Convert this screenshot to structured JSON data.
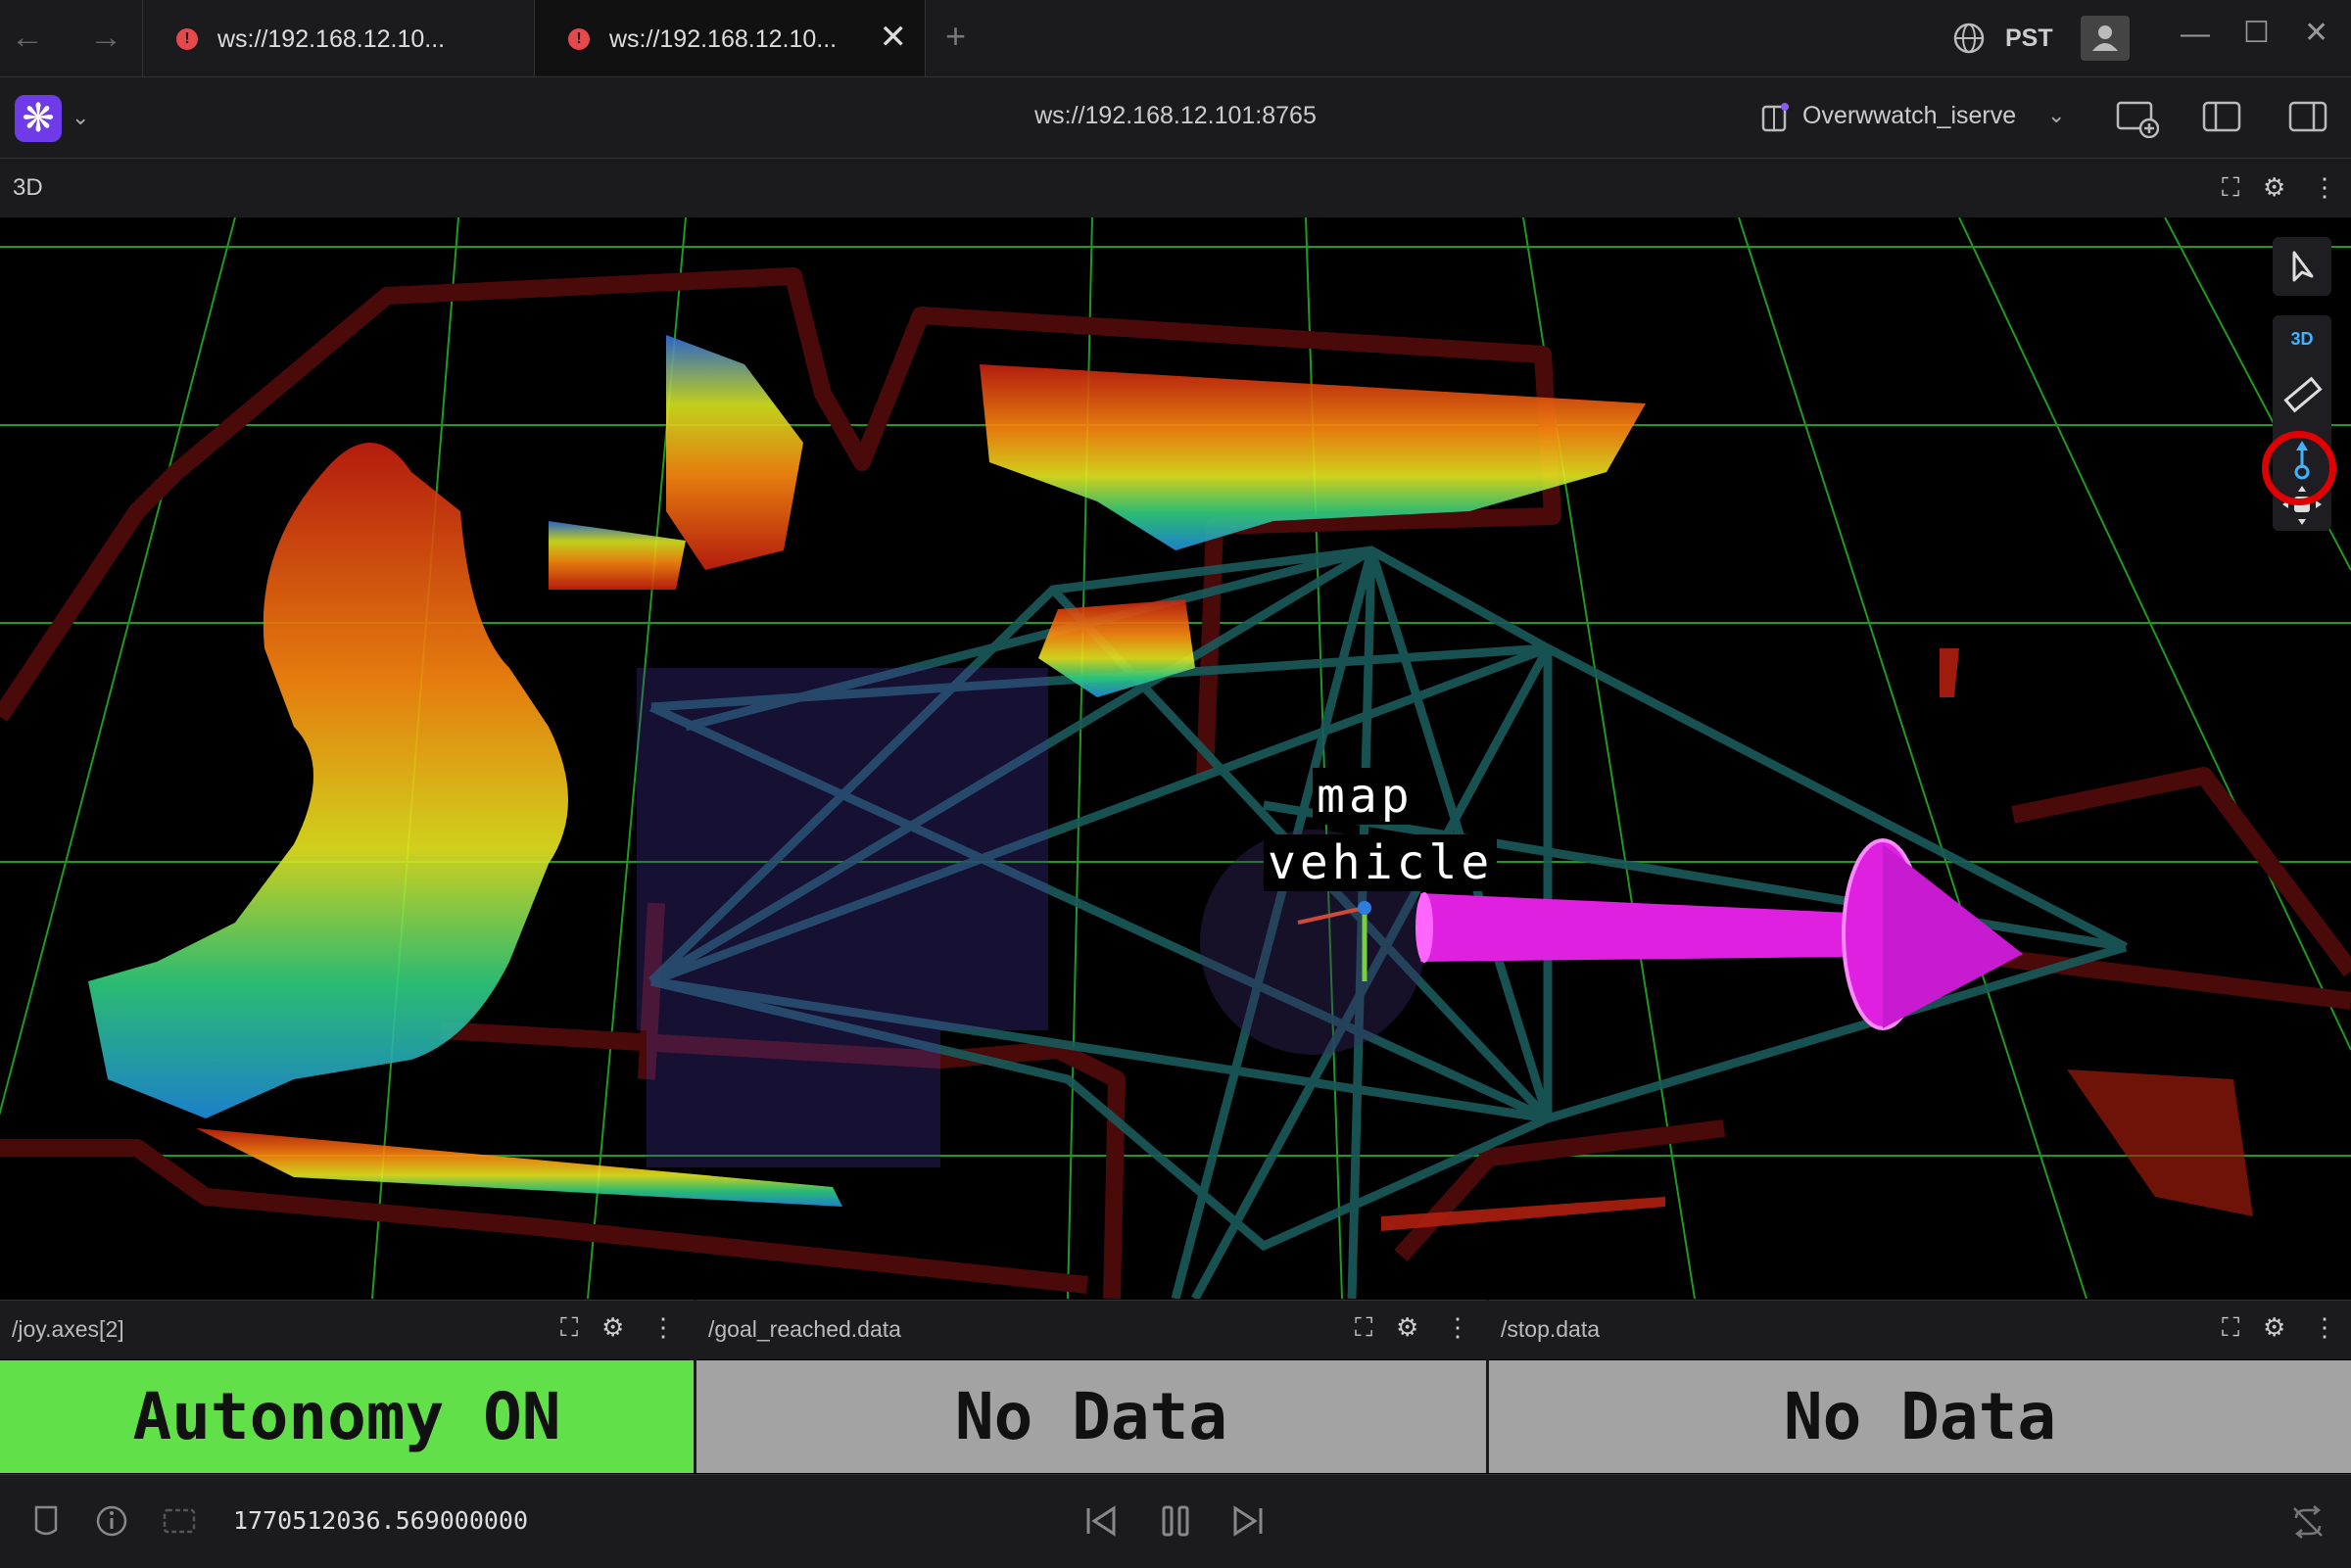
{
  "browser": {
    "tabs": [
      {
        "title": "ws://192.168.12.10...",
        "status": "error-icon",
        "active": false
      },
      {
        "title": "ws://192.168.12.10...",
        "status": "error-icon",
        "active": true
      }
    ]
  },
  "header": {
    "connection_url": "ws://192.168.12.101:8765",
    "layout_name": "Overwwatch_iserve",
    "timezone": "PST"
  },
  "panel3d": {
    "title": "3D",
    "toolbar": [
      "cursor-icon",
      "3d-toggle",
      "ruler-icon",
      "publish-pose-icon",
      "move-icon"
    ],
    "mode_label": "3D",
    "labels": {
      "map": "map",
      "vehicle": "vehicle"
    }
  },
  "indicators": [
    {
      "topic": "/joy.axes[2]",
      "text": "Autonomy ON",
      "color": "#62e04a"
    },
    {
      "topic": "/goal_reached.data",
      "text": "No Data",
      "color": "#a3a3a3"
    },
    {
      "topic": "/stop.data",
      "text": "No Data",
      "color": "#a3a3a3"
    }
  ],
  "playback": {
    "timestamp": "1770512036.569000000"
  }
}
